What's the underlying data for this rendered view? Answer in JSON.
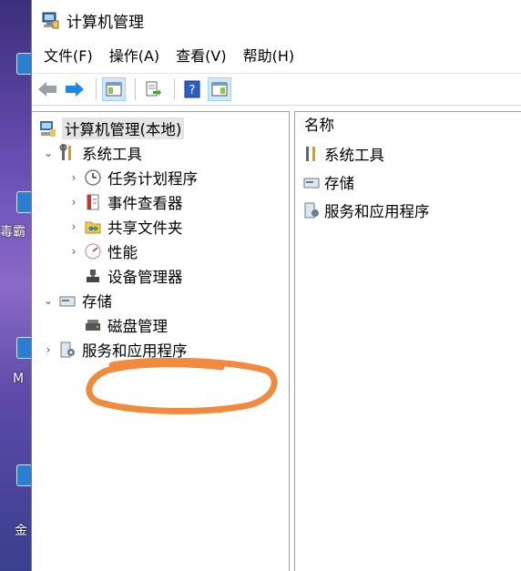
{
  "window": {
    "title": "计算机管理"
  },
  "menu": [
    "文件(F)",
    "操作(A)",
    "查看(V)",
    "帮助(H)"
  ],
  "toolbar_icons": [
    "back-arrow-icon",
    "forward-arrow-icon",
    "show-hide-tree-icon",
    "export-list-icon",
    "help-icon",
    "show-action-pane-icon"
  ],
  "tree": {
    "root": "计算机管理(本地)",
    "system_tools": "系统工具",
    "task_scheduler": "任务计划程序",
    "event_viewer": "事件查看器",
    "shared_folders": "共享文件夹",
    "performance": "性能",
    "device_manager": "设备管理器",
    "storage": "存储",
    "disk_management": "磁盘管理",
    "services_apps": "服务和应用程序"
  },
  "list": {
    "header": "名称",
    "items": [
      "系统工具",
      "存储",
      "服务和应用程序"
    ]
  },
  "desktop": {
    "label1": "毒霸",
    "label2": "M",
    "label3": "金"
  },
  "annotation_color": "#f08a3e",
  "selection_color": "#e5e5e5"
}
